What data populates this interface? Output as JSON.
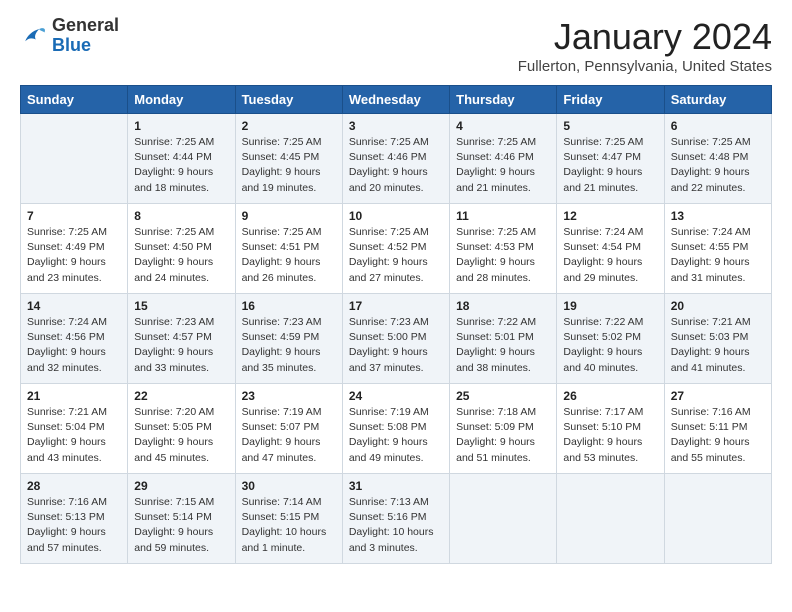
{
  "header": {
    "logo_general": "General",
    "logo_blue": "Blue",
    "month_title": "January 2024",
    "location": "Fullerton, Pennsylvania, United States"
  },
  "weekdays": [
    "Sunday",
    "Monday",
    "Tuesday",
    "Wednesday",
    "Thursday",
    "Friday",
    "Saturday"
  ],
  "weeks": [
    [
      {
        "day": "",
        "info": ""
      },
      {
        "day": "1",
        "info": "Sunrise: 7:25 AM\nSunset: 4:44 PM\nDaylight: 9 hours\nand 18 minutes."
      },
      {
        "day": "2",
        "info": "Sunrise: 7:25 AM\nSunset: 4:45 PM\nDaylight: 9 hours\nand 19 minutes."
      },
      {
        "day": "3",
        "info": "Sunrise: 7:25 AM\nSunset: 4:46 PM\nDaylight: 9 hours\nand 20 minutes."
      },
      {
        "day": "4",
        "info": "Sunrise: 7:25 AM\nSunset: 4:46 PM\nDaylight: 9 hours\nand 21 minutes."
      },
      {
        "day": "5",
        "info": "Sunrise: 7:25 AM\nSunset: 4:47 PM\nDaylight: 9 hours\nand 21 minutes."
      },
      {
        "day": "6",
        "info": "Sunrise: 7:25 AM\nSunset: 4:48 PM\nDaylight: 9 hours\nand 22 minutes."
      }
    ],
    [
      {
        "day": "7",
        "info": "Sunrise: 7:25 AM\nSunset: 4:49 PM\nDaylight: 9 hours\nand 23 minutes."
      },
      {
        "day": "8",
        "info": "Sunrise: 7:25 AM\nSunset: 4:50 PM\nDaylight: 9 hours\nand 24 minutes."
      },
      {
        "day": "9",
        "info": "Sunrise: 7:25 AM\nSunset: 4:51 PM\nDaylight: 9 hours\nand 26 minutes."
      },
      {
        "day": "10",
        "info": "Sunrise: 7:25 AM\nSunset: 4:52 PM\nDaylight: 9 hours\nand 27 minutes."
      },
      {
        "day": "11",
        "info": "Sunrise: 7:25 AM\nSunset: 4:53 PM\nDaylight: 9 hours\nand 28 minutes."
      },
      {
        "day": "12",
        "info": "Sunrise: 7:24 AM\nSunset: 4:54 PM\nDaylight: 9 hours\nand 29 minutes."
      },
      {
        "day": "13",
        "info": "Sunrise: 7:24 AM\nSunset: 4:55 PM\nDaylight: 9 hours\nand 31 minutes."
      }
    ],
    [
      {
        "day": "14",
        "info": "Sunrise: 7:24 AM\nSunset: 4:56 PM\nDaylight: 9 hours\nand 32 minutes."
      },
      {
        "day": "15",
        "info": "Sunrise: 7:23 AM\nSunset: 4:57 PM\nDaylight: 9 hours\nand 33 minutes."
      },
      {
        "day": "16",
        "info": "Sunrise: 7:23 AM\nSunset: 4:59 PM\nDaylight: 9 hours\nand 35 minutes."
      },
      {
        "day": "17",
        "info": "Sunrise: 7:23 AM\nSunset: 5:00 PM\nDaylight: 9 hours\nand 37 minutes."
      },
      {
        "day": "18",
        "info": "Sunrise: 7:22 AM\nSunset: 5:01 PM\nDaylight: 9 hours\nand 38 minutes."
      },
      {
        "day": "19",
        "info": "Sunrise: 7:22 AM\nSunset: 5:02 PM\nDaylight: 9 hours\nand 40 minutes."
      },
      {
        "day": "20",
        "info": "Sunrise: 7:21 AM\nSunset: 5:03 PM\nDaylight: 9 hours\nand 41 minutes."
      }
    ],
    [
      {
        "day": "21",
        "info": "Sunrise: 7:21 AM\nSunset: 5:04 PM\nDaylight: 9 hours\nand 43 minutes."
      },
      {
        "day": "22",
        "info": "Sunrise: 7:20 AM\nSunset: 5:05 PM\nDaylight: 9 hours\nand 45 minutes."
      },
      {
        "day": "23",
        "info": "Sunrise: 7:19 AM\nSunset: 5:07 PM\nDaylight: 9 hours\nand 47 minutes."
      },
      {
        "day": "24",
        "info": "Sunrise: 7:19 AM\nSunset: 5:08 PM\nDaylight: 9 hours\nand 49 minutes."
      },
      {
        "day": "25",
        "info": "Sunrise: 7:18 AM\nSunset: 5:09 PM\nDaylight: 9 hours\nand 51 minutes."
      },
      {
        "day": "26",
        "info": "Sunrise: 7:17 AM\nSunset: 5:10 PM\nDaylight: 9 hours\nand 53 minutes."
      },
      {
        "day": "27",
        "info": "Sunrise: 7:16 AM\nSunset: 5:11 PM\nDaylight: 9 hours\nand 55 minutes."
      }
    ],
    [
      {
        "day": "28",
        "info": "Sunrise: 7:16 AM\nSunset: 5:13 PM\nDaylight: 9 hours\nand 57 minutes."
      },
      {
        "day": "29",
        "info": "Sunrise: 7:15 AM\nSunset: 5:14 PM\nDaylight: 9 hours\nand 59 minutes."
      },
      {
        "day": "30",
        "info": "Sunrise: 7:14 AM\nSunset: 5:15 PM\nDaylight: 10 hours\nand 1 minute."
      },
      {
        "day": "31",
        "info": "Sunrise: 7:13 AM\nSunset: 5:16 PM\nDaylight: 10 hours\nand 3 minutes."
      },
      {
        "day": "",
        "info": ""
      },
      {
        "day": "",
        "info": ""
      },
      {
        "day": "",
        "info": ""
      }
    ]
  ]
}
